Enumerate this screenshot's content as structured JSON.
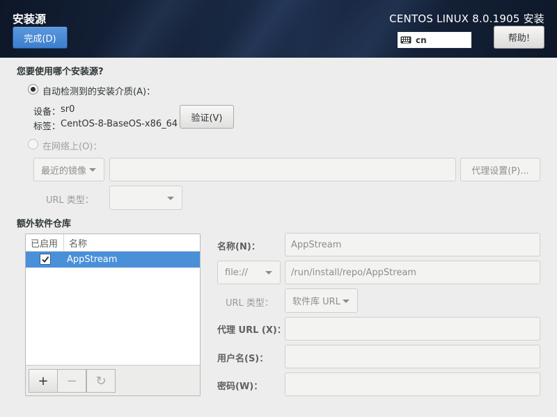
{
  "header": {
    "title": "安装源",
    "done_label": "完成(D)",
    "product": "CENTOS LINUX 8.0.1905 安装",
    "keyboard_layout": "cn",
    "help_label": "帮助!"
  },
  "source": {
    "question": "您要使用哪个安装源?",
    "auto_detect_label": "自动检测到的安装介质(A)：",
    "device_label": "设备：",
    "device_value": "sr0",
    "tag_label": "标签：",
    "tag_value": "CentOS-8-BaseOS-x86_64",
    "verify_label": "验证(V)",
    "network_label": "在网络上(O)：",
    "mirror_combo": "最近的镜像",
    "url_value": "",
    "proxy_button": "代理设置(P)...",
    "url_type_label": "URL 类型：",
    "url_type_value": ""
  },
  "repos": {
    "heading": "额外软件仓库",
    "col_enabled": "已启用",
    "col_name": "名称",
    "items": [
      {
        "enabled": true,
        "name": "AppStream"
      }
    ],
    "add_label": "+",
    "remove_label": "−",
    "refresh_label": "↻"
  },
  "repo_details": {
    "name_label": "名称(N)：",
    "name_value": "AppStream",
    "protocol": "file://",
    "url_value": "/run/install/repo/AppStream",
    "url_type_label": "URL 类型：",
    "url_type_value": "软件库 URL",
    "proxy_label": "代理 URL (X)：",
    "proxy_value": "",
    "username_label": "用户名(S)：",
    "username_value": "",
    "password_label": "密码(W)：",
    "password_value": ""
  },
  "colors": {
    "header_bg": "#17253d",
    "accent": "#4a90d9",
    "window_bg": "#ededed"
  }
}
